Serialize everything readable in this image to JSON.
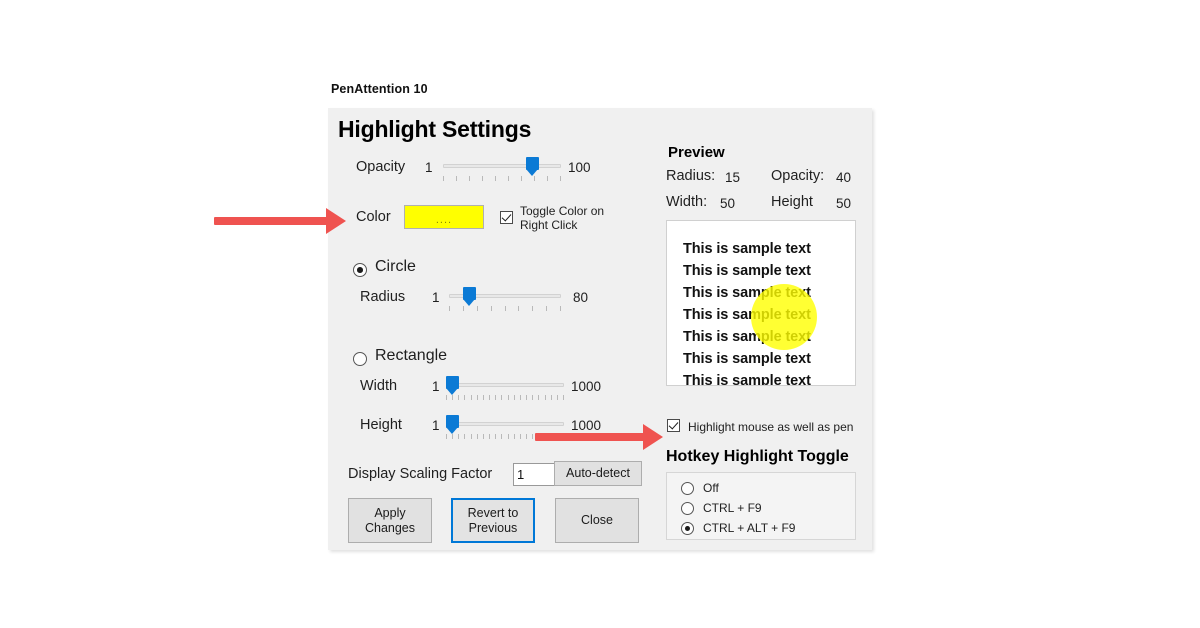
{
  "window": {
    "caption": "PenAttention 10",
    "title": "Highlight Settings"
  },
  "opacity": {
    "label": "Opacity",
    "min": "1",
    "max": "100",
    "value": 75
  },
  "color": {
    "label": "Color",
    "swatch_hex": "#ffff00",
    "ellipsis": "....",
    "toggle_line1": "Toggle Color on",
    "toggle_line2": "Right Click",
    "toggle_checked": true
  },
  "shape": {
    "circle_label": "Circle",
    "circle_selected": true,
    "rectangle_label": "Rectangle",
    "rectangle_selected": false
  },
  "radius": {
    "label": "Radius",
    "min": "1",
    "max": "80",
    "value": 18
  },
  "width": {
    "label": "Width",
    "min": "1",
    "max": "1000",
    "value": 5
  },
  "height": {
    "label": "Height",
    "min": "1",
    "max": "1000",
    "value": 5
  },
  "scaling": {
    "label": "Display Scaling Factor",
    "value": "1",
    "autodetect_label": "Auto-detect"
  },
  "buttons": {
    "apply": "Apply\nChanges",
    "revert": "Revert to\nPrevious",
    "close": "Close"
  },
  "preview": {
    "title": "Preview",
    "radius_label": "Radius:",
    "radius_value": "15",
    "opacity_label": "Opacity:",
    "opacity_value": "40",
    "width_label": "Width:",
    "width_value": "50",
    "height_label": "Height",
    "height_value": "50",
    "sample_text": "This is sample text",
    "sample_lines": [
      "This is sample text",
      "This is sample text",
      "This is sample text",
      "This is sample text",
      "This is sample text",
      "This is sample text",
      "This is sample text"
    ],
    "highlight_color": "#ffff00"
  },
  "mouse_highlight": {
    "label": "Highlight mouse as well as pen",
    "checked": true
  },
  "hotkey": {
    "title": "Hotkey Highlight Toggle",
    "options": [
      {
        "label": "Off",
        "selected": false
      },
      {
        "label": "CTRL + F9",
        "selected": false
      },
      {
        "label": "CTRL + ALT + F9",
        "selected": true
      }
    ]
  },
  "annotations": {
    "arrow_color": "#ef5350",
    "arrow1_target": "Color",
    "arrow2_target": "Highlight mouse as well as pen"
  }
}
